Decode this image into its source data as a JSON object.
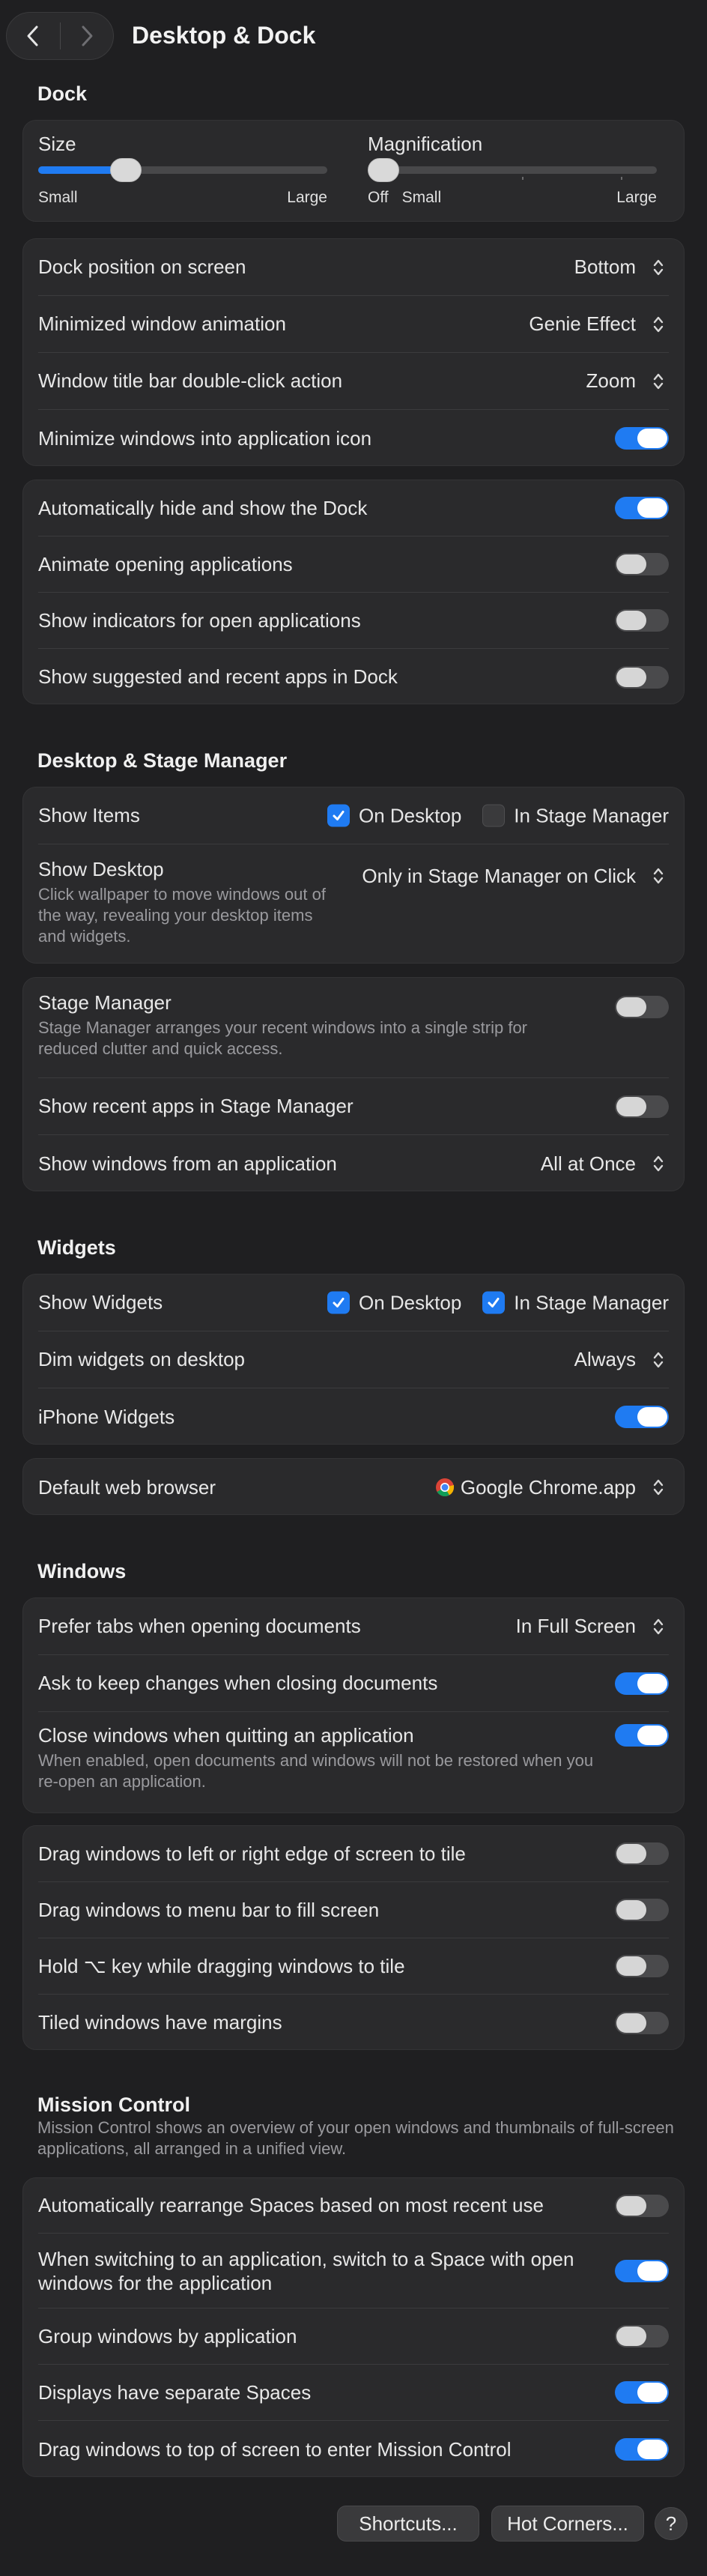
{
  "window": {
    "title": "Desktop & Dock"
  },
  "dock": {
    "section_title": "Dock",
    "size": {
      "label": "Size",
      "min_label": "Small",
      "max_label": "Large",
      "value": 0.28
    },
    "magnification": {
      "label": "Magnification",
      "off_label": "Off",
      "min_label": "Small",
      "max_label": "Large",
      "value": 0.0
    },
    "position": {
      "label": "Dock position on screen",
      "value": "Bottom"
    },
    "minimize_animation": {
      "label": "Minimized window animation",
      "value": "Genie Effect"
    },
    "double_click": {
      "label": "Window title bar double-click action",
      "value": "Zoom"
    },
    "minimize_into_icon": {
      "label": "Minimize windows into application icon",
      "on": true
    },
    "autohide": {
      "label": "Automatically hide and show the Dock",
      "on": true
    },
    "animate_opening": {
      "label": "Animate opening applications",
      "on": false
    },
    "show_indicators": {
      "label": "Show indicators for open applications",
      "on": false
    },
    "show_suggested": {
      "label": "Show suggested and recent apps in Dock",
      "on": false
    }
  },
  "stage": {
    "section_title": "Desktop & Stage Manager",
    "show_items": {
      "label": "Show Items",
      "on_desktop": "On Desktop",
      "in_stage_manager": "In Stage Manager",
      "desktop_checked": true,
      "stage_checked": false
    },
    "show_desktop": {
      "label": "Show Desktop",
      "description": "Click wallpaper to move windows out of the way, revealing your desktop items and widgets.",
      "value": "Only in Stage Manager on Click"
    },
    "stage_manager": {
      "label": "Stage Manager",
      "description": "Stage Manager arranges your recent windows into a single strip for reduced clutter and quick access.",
      "on": false
    },
    "recent_apps": {
      "label": "Show recent apps in Stage Manager",
      "on": false
    },
    "windows_from_app": {
      "label": "Show windows from an application",
      "value": "All at Once"
    }
  },
  "widgets": {
    "section_title": "Widgets",
    "show_widgets": {
      "label": "Show Widgets",
      "on_desktop": "On Desktop",
      "in_stage_manager": "In Stage Manager",
      "desktop_checked": true,
      "stage_checked": true
    },
    "dim_widgets": {
      "label": "Dim widgets on desktop",
      "value": "Always"
    },
    "iphone_widgets": {
      "label": "iPhone Widgets",
      "on": true
    },
    "browser": {
      "label": "Default web browser",
      "value": "Google Chrome.app"
    }
  },
  "windows": {
    "section_title": "Windows",
    "prefer_tabs": {
      "label": "Prefer tabs when opening documents",
      "value": "In Full Screen"
    },
    "ask_keep": {
      "label": "Ask to keep changes when closing documents",
      "on": true
    },
    "close_windows": {
      "label": "Close windows when quitting an application",
      "description": "When enabled, open documents and windows will not be restored when you re-open an application.",
      "on": true
    },
    "drag_edge": {
      "label": "Drag windows to left or right edge of screen to tile",
      "on": false
    },
    "drag_menubar": {
      "label": "Drag windows to menu bar to fill screen",
      "on": false
    },
    "hold_option": {
      "label": "Hold ⌥ key while dragging windows to tile",
      "on": false
    },
    "tiled_margins": {
      "label": "Tiled windows have margins",
      "on": false
    }
  },
  "mission": {
    "section_title": "Mission Control",
    "description": "Mission Control shows an overview of your open windows and thumbnails of full-screen applications, all arranged in a unified view.",
    "rearrange": {
      "label": "Automatically rearrange Spaces based on most recent use",
      "on": false
    },
    "switch_space": {
      "label": "When switching to an application, switch to a Space with open windows for the application",
      "on": true
    },
    "group_windows": {
      "label": "Group windows by application",
      "on": false
    },
    "separate_spaces": {
      "label": "Displays have separate Spaces",
      "on": true
    },
    "drag_top": {
      "label": "Drag windows to top of screen to enter Mission Control",
      "on": true
    }
  },
  "footer": {
    "shortcuts": "Shortcuts...",
    "hot_corners": "Hot Corners...",
    "help": "?"
  },
  "colors": {
    "accent": "#1f7bf2",
    "background": "#1f1f21",
    "card": "#2a2a2c"
  },
  "icons": [
    "chevron-left-icon",
    "chevron-right-icon",
    "stepper-icon",
    "checkmark-icon",
    "chrome-icon"
  ]
}
